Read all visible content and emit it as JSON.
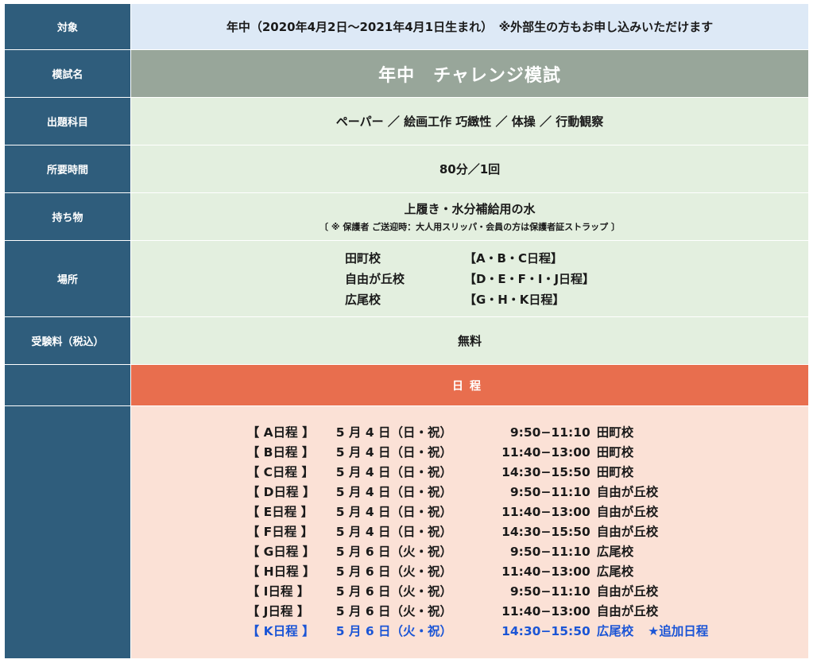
{
  "rows": {
    "target": {
      "label": "対象",
      "value": "年中（2020年4月2日～2021年4月1日生まれ）　※外部生の方もお申し込みいただけます"
    },
    "exam_name": {
      "label": "模試名",
      "value": "年中　チャレンジ模試"
    },
    "subjects": {
      "label": "出題科目",
      "value": "ペーパー ／ 絵画工作 巧緻性 ／ 体操 ／ 行動観察"
    },
    "duration": {
      "label": "所要時間",
      "value": "80分／1回"
    },
    "belongings": {
      "label": "持ち物",
      "value": "上履き・水分補給用の水",
      "note": "〔 ※ 保護者 ご送迎時：大人用スリッパ・会員の方は保護者証ストラップ 〕"
    },
    "location": {
      "label": "場所",
      "items": [
        {
          "name": "田町校",
          "days": "【A・B・C日程】"
        },
        {
          "name": "自由が丘校",
          "days": "【D・E・F・I・J日程】"
        },
        {
          "name": "広尾校",
          "days": "【G・H・K日程】"
        }
      ]
    },
    "fee": {
      "label": "受験料（税込）",
      "value": "無料"
    }
  },
  "schedule": {
    "header": "日程",
    "items": [
      {
        "code": "【 A日程 】",
        "date": "5 月 4 日（日・祝）",
        "time": "9:50−11:10",
        "place": "田町校",
        "note": ""
      },
      {
        "code": "【 B日程 】",
        "date": "5 月 4 日（日・祝）",
        "time": "11:40−13:00",
        "place": "田町校",
        "note": ""
      },
      {
        "code": "【 C日程 】",
        "date": "5 月 4 日（日・祝）",
        "time": "14:30−15:50",
        "place": "田町校",
        "note": ""
      },
      {
        "code": "【 D日程 】",
        "date": "5 月 4 日（日・祝）",
        "time": "9:50−11:10",
        "place": "自由が丘校",
        "note": ""
      },
      {
        "code": "【 E日程 】",
        "date": "5 月 4 日（日・祝）",
        "time": "11:40−13:00",
        "place": "自由が丘校",
        "note": ""
      },
      {
        "code": "【 F日程 】",
        "date": "5 月 4 日（日・祝）",
        "time": "14:30−15:50",
        "place": "自由が丘校",
        "note": ""
      },
      {
        "code": "【 G日程 】",
        "date": "5 月 6 日（火・祝）",
        "time": "9:50−11:10",
        "place": "広尾校",
        "note": ""
      },
      {
        "code": "【 H日程 】",
        "date": "5 月 6 日（火・祝）",
        "time": "11:40−13:00",
        "place": "広尾校",
        "note": ""
      },
      {
        "code": "【 I日程 】",
        "date": "5 月 6 日（火・祝）",
        "time": "9:50−11:10",
        "place": "自由が丘校",
        "note": ""
      },
      {
        "code": "【 J日程 】",
        "date": "5 月 6 日（火・祝）",
        "time": "11:40−13:00",
        "place": "自由が丘校",
        "note": ""
      },
      {
        "code": "【 K日程 】",
        "date": "5 月 6 日（火・祝）",
        "time": "14:30−15:50",
        "place": "広尾校",
        "note": "★追加日程"
      }
    ]
  },
  "colors": {
    "label_bg": "#2f5d7c",
    "target_bg": "#dde9f6",
    "title_bg": "#98a69a",
    "info_bg": "#e3efdf",
    "schedule_header_bg": "#e86e4e",
    "schedule_bg": "#fbe1d6",
    "added_schedule_text": "#1b55d6"
  }
}
